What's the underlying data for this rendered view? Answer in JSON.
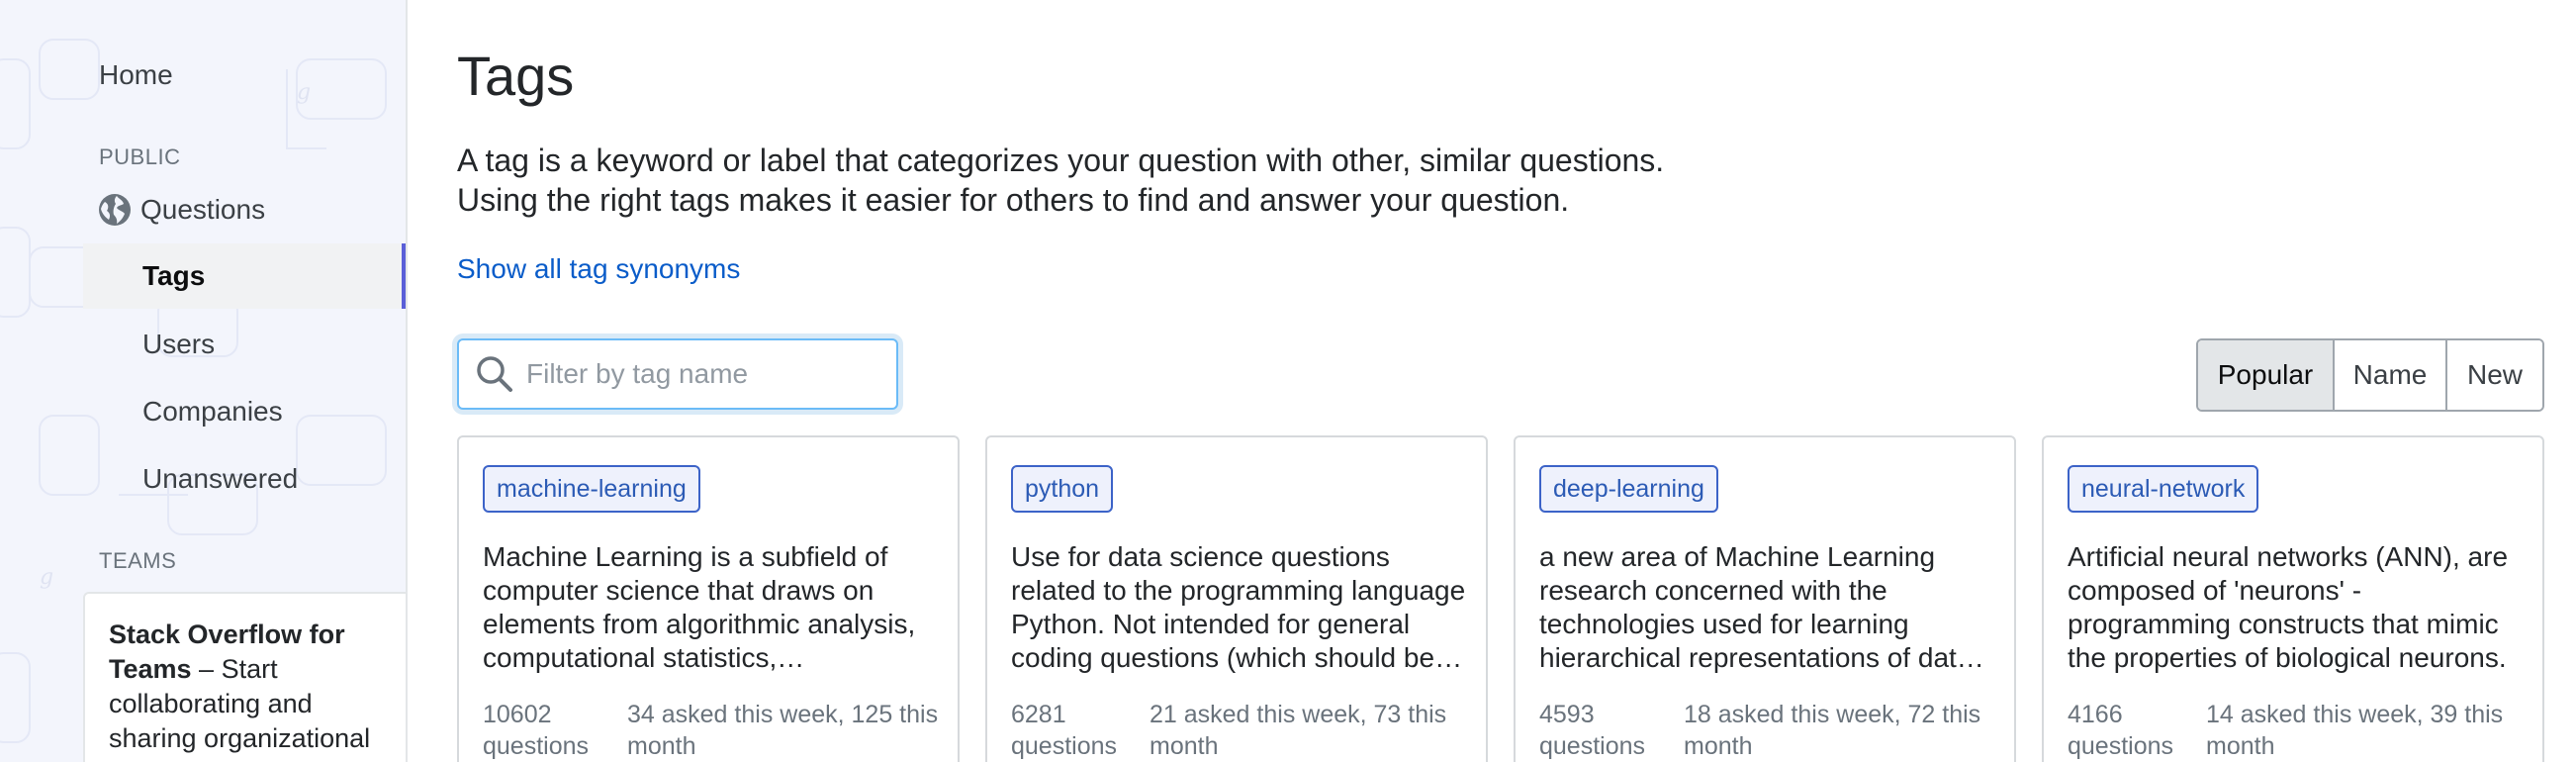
{
  "sidebar": {
    "home": "Home",
    "public_heading": "PUBLIC",
    "questions": "Questions",
    "tags": "Tags",
    "users": "Users",
    "companies": "Companies",
    "unanswered": "Unanswered",
    "teams_heading": "TEAMS",
    "teams_card": {
      "title": "Stack Overflow for Teams",
      "body": " – Start collaborating and sharing organizational knowledge."
    }
  },
  "main": {
    "title": "Tags",
    "description_line1": "A tag is a keyword or label that categorizes your question with other, similar questions.",
    "description_line2": "Using the right tags makes it easier for others to find and answer your question.",
    "synonyms_link": "Show all tag synonyms",
    "filter_placeholder": "Filter by tag name",
    "filter_value": "",
    "sort": {
      "popular": "Popular",
      "name": "Name",
      "new": "New",
      "selected": "Popular"
    },
    "tags": [
      {
        "name": "machine-learning",
        "description": "Machine Learning is a subfield of computer science that draws on elements from algorithmic analysis, computational statistics, mathematics, optimization, etc.",
        "count": "10602",
        "count_unit": "questions",
        "activity": "34 asked this week, 125 this month"
      },
      {
        "name": "python",
        "description": "Use for data science questions related to the programming language Python. Not intended for general coding questions (which should be asked on Stack Overflow).",
        "count": "6281",
        "count_unit": "questions",
        "activity": "21 asked this week, 73 this month"
      },
      {
        "name": "deep-learning",
        "description": "a new area of Machine Learning research concerned with the technologies used for learning hierarchical representations of data, mainly done with deep neural networks.",
        "count": "4593",
        "count_unit": "questions",
        "activity": "18 asked this week, 72 this month"
      },
      {
        "name": "neural-network",
        "description": "Artificial neural networks (ANN), are composed of 'neurons' - programming constructs that mimic the properties of biological neurons.",
        "count": "4166",
        "count_unit": "questions",
        "activity": "14 asked this week, 39 this month"
      }
    ]
  },
  "colors": {
    "sidebar_bg": "#f3f5fc",
    "active_indicator": "#5a5fd8",
    "link": "#0a5cc9",
    "tag_border": "#3c63c8"
  }
}
